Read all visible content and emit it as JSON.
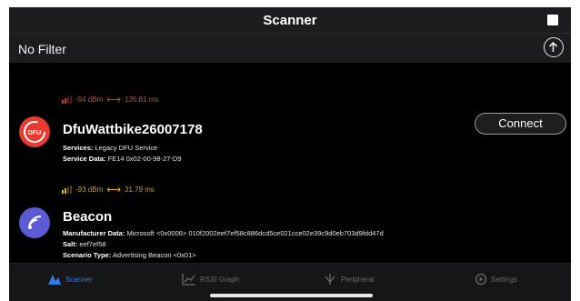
{
  "header": {
    "title": "Scanner"
  },
  "filter": {
    "label": "No Filter"
  },
  "devices": [
    {
      "rssi": "-94 dBm",
      "interval": "135.81 ms",
      "name": "DfuWattbike26007178",
      "icon_text": "DFU",
      "line1_label": "Services:",
      "line1_value": "Legacy DFU Service",
      "line2_label": "Service Data:",
      "line2_value": "FE14 0x02-00-98-27-D9",
      "connect_label": "Connect",
      "icon_color": "#e63b2e"
    },
    {
      "rssi": "-93 dBm",
      "interval": "31.79 ms",
      "name": "Beacon",
      "line1_label": "Manufacturer Data:",
      "line1_value": "Microsoft <0x0006> 010f2002eef7ef58c886dcd5ce021cce02e39c9d0eb703d9fdd47d",
      "line2_label": "Salt:",
      "line2_value": "eef7ef58",
      "line3_label": "Scenario Type:",
      "line3_value": "Advertising Beacon <0x01>",
      "icon_color": "#5b5bd6"
    }
  ],
  "tabs": [
    {
      "label": "Scanner",
      "icon": "scanner-icon",
      "active": true
    },
    {
      "label": "RSSI Graph",
      "icon": "graph-icon",
      "active": false
    },
    {
      "label": "Peripheral",
      "icon": "peripheral-icon",
      "active": false
    },
    {
      "label": "Settings",
      "icon": "settings-icon",
      "active": false
    }
  ],
  "colors": {
    "accent": "#2d7de2",
    "signal_red": "#d33333",
    "signal_yellow": "#e8b800"
  }
}
